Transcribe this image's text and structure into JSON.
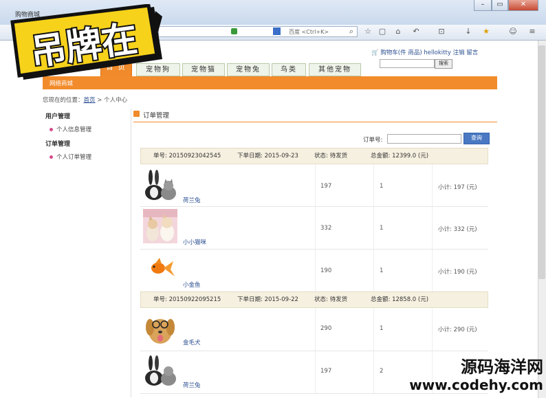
{
  "browser": {
    "window_title": "购物商城",
    "url_hint": "百度 <Ctrl+K>"
  },
  "site": {
    "top_links": {
      "cart": "购物车(件 商品)",
      "user": "hellokitty",
      "logout": "注销",
      "message": "留言"
    },
    "search_button": "搜索",
    "tabs": [
      "首 页",
      "宠物狗",
      "宠物猫",
      "宠物兔",
      "鸟类",
      "其他宠物"
    ],
    "orange_label": "网络商城",
    "breadcrumb": {
      "prefix": "您现在的位置：",
      "home": "首页",
      "sep": " > ",
      "current": "个人中心"
    }
  },
  "menu": {
    "user_head": "用户管理",
    "user_item": "个人信息管理",
    "order_head": "订单管理",
    "order_item": "个人订单管理"
  },
  "main": {
    "title": "订单管理",
    "order_label": "订单号:",
    "search_button": "查询"
  },
  "orders": [
    {
      "id": "单号: 20150923042545",
      "date": "下单日期: 2015-09-23",
      "status": "状态: 待发货",
      "total": "总金额: 12399.0 (元)",
      "items": [
        {
          "name": "荷兰兔",
          "price": "197",
          "qty": "1",
          "subtotal": "小计: 197 (元)",
          "img": "rabbit-cat"
        },
        {
          "name": "小小猫咪",
          "price": "332",
          "qty": "1",
          "subtotal": "小计: 332 (元)",
          "img": "kittens"
        },
        {
          "name": "小金鱼",
          "price": "190",
          "qty": "1",
          "subtotal": "小计: 190 (元)",
          "img": "goldfish"
        }
      ]
    },
    {
      "id": "单号: 20150922095215",
      "date": "下单日期: 2015-09-22",
      "status": "状态: 待发货",
      "total": "总金额: 12858.0 (元)",
      "items": [
        {
          "name": "金毛犬",
          "price": "290",
          "qty": "1",
          "subtotal": "小计: 290 (元)",
          "img": "dog"
        },
        {
          "name": "荷兰兔",
          "price": "197",
          "qty": "2",
          "subtotal": "",
          "img": "rabbit-cat"
        }
      ]
    }
  ],
  "watermark": {
    "banner": "吊牌在",
    "site_cn": "源码海洋网",
    "site_url": "www.codehy.com"
  },
  "colors": {
    "accent": "#f28b2b",
    "link": "#2b4f91",
    "button_blue": "#4a78c2"
  }
}
